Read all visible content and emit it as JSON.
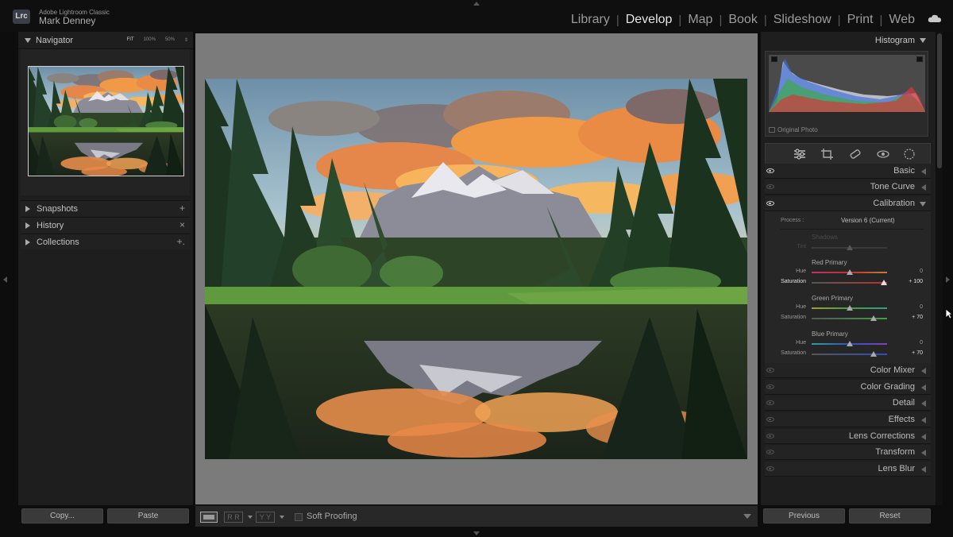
{
  "app": {
    "name": "Adobe Lightroom Classic",
    "logo_text": "Lrc",
    "user": "Mark Denney"
  },
  "modules": [
    {
      "label": "Library",
      "active": false
    },
    {
      "label": "Develop",
      "active": true
    },
    {
      "label": "Map",
      "active": false
    },
    {
      "label": "Book",
      "active": false
    },
    {
      "label": "Slideshow",
      "active": false
    },
    {
      "label": "Print",
      "active": false
    },
    {
      "label": "Web",
      "active": false
    }
  ],
  "module_separator": "|",
  "left_panel": {
    "navigator": {
      "title": "Navigator",
      "zooms": [
        "FIT",
        "100%",
        "50%",
        "⇕"
      ]
    },
    "panels": [
      {
        "label": "Snapshots",
        "action": "+"
      },
      {
        "label": "History",
        "action": "×"
      },
      {
        "label": "Collections",
        "action": "+."
      }
    ],
    "copy_label": "Copy...",
    "paste_label": "Paste"
  },
  "toolbar": {
    "rr_label": "R R",
    "yy_label": "Y Y",
    "soft_proofing_label": "Soft Proofing"
  },
  "right_panel": {
    "histogram_title": "Histogram",
    "original_photo_label": "Original Photo",
    "tools": [
      "edit-sliders-icon",
      "crop-icon",
      "healing-icon",
      "redeye-icon",
      "masking-icon"
    ],
    "sections_top": [
      {
        "label": "Basic",
        "eye_on": true
      },
      {
        "label": "Tone Curve",
        "eye_on": false
      },
      {
        "label": "Calibration",
        "eye_on": true,
        "open": true
      }
    ],
    "calibration": {
      "process_label": "Process :",
      "process_value": "Version 6 (Current)",
      "shadows": {
        "title": "Shadows",
        "tint_label": "Tint",
        "tint_value": ""
      },
      "red": {
        "title": "Red Primary",
        "hue_label": "Hue",
        "hue_value": "0",
        "sat_label": "Saturation",
        "sat_value": "+ 100"
      },
      "green": {
        "title": "Green Primary",
        "hue_label": "Hue",
        "hue_value": "0",
        "sat_label": "Saturation",
        "sat_value": "+ 70"
      },
      "blue": {
        "title": "Blue Primary",
        "hue_label": "Hue",
        "hue_value": "0",
        "sat_label": "Saturation",
        "sat_value": "+ 70"
      }
    },
    "sections_bottom": [
      {
        "label": "Color Mixer"
      },
      {
        "label": "Color Grading"
      },
      {
        "label": "Detail"
      },
      {
        "label": "Effects"
      },
      {
        "label": "Lens Corrections"
      },
      {
        "label": "Transform"
      },
      {
        "label": "Lens Blur"
      }
    ],
    "previous_label": "Previous",
    "reset_label": "Reset"
  }
}
